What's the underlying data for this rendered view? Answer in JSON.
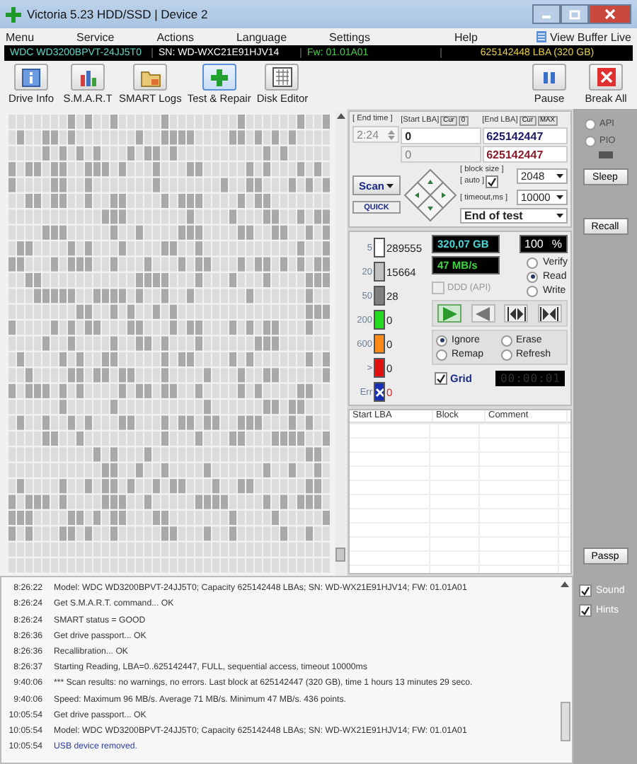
{
  "window": {
    "title": "Victoria 5.23 HDD/SSD | Device 2"
  },
  "menu": [
    {
      "label": "Menu"
    },
    {
      "label": "Service"
    },
    {
      "label": "Actions"
    },
    {
      "label": "Language"
    },
    {
      "label": "Settings"
    }
  ],
  "menu_right": {
    "help": "Help",
    "view_buffer": "View Buffer Live"
  },
  "drive_bar": {
    "model": "WDC WD3200BPVT-24JJ5T0",
    "serial": "SN: WD-WXC21E91HJV14",
    "firmware": "Fw: 01.01A01",
    "capacity": "625142448 LBA (320 GB)"
  },
  "toolbar": [
    {
      "label": "Drive Info",
      "kind": "info",
      "selected": false
    },
    {
      "label": "S.M.A.R.T",
      "kind": "smart",
      "selected": false
    },
    {
      "label": "SMART Logs",
      "kind": "logs",
      "selected": false
    },
    {
      "label": "Test & Repair",
      "kind": "test",
      "selected": true
    },
    {
      "label": "Disk Editor",
      "kind": "editor",
      "selected": false
    }
  ],
  "toolbar_right": [
    {
      "label": "Pause",
      "kind": "pause"
    },
    {
      "label": "Break All",
      "kind": "break"
    }
  ],
  "scan": {
    "end_time_label": "[ End time ]",
    "end_time": "2:24",
    "start_lba_label": "[Start LBA]",
    "start_cur": "Cur",
    "start_zero": "0",
    "end_lba_label": "[End LBA]",
    "end_cur": "Cur",
    "end_max": "MAX",
    "start_lba": "0",
    "end_lba": "625142447",
    "current_start": "0",
    "current_end": "625142447",
    "scan_button": "Scan",
    "quick": "QUICK",
    "block_size_label": "[ block size ]",
    "auto_label": "[ auto ]",
    "auto_checked": true,
    "block_size": "2048",
    "timeout_label": "[ timeout,ms ]",
    "timeout": "10000",
    "end_mode": "End of test"
  },
  "counters": [
    {
      "label": "5",
      "value": "289555",
      "color": "#ffffff",
      "kind": "block"
    },
    {
      "label": "20",
      "value": "15664",
      "color": "#c0c0c0",
      "kind": "block"
    },
    {
      "label": "50",
      "value": "28",
      "color": "#7f7f7f",
      "kind": "block"
    },
    {
      "label": "200",
      "value": "0",
      "color": "#22dd22",
      "kind": "block"
    },
    {
      "label": "600",
      "value": "0",
      "color": "#ff8a1a",
      "kind": "block"
    },
    {
      "label": ">",
      "value": "0",
      "color": "#e01010",
      "kind": "block"
    },
    {
      "label": "Err",
      "value": "0",
      "color": "#1a2fb0",
      "kind": "error"
    }
  ],
  "stats": {
    "size": "320,07 GB",
    "percent": "100",
    "percent_unit": "%",
    "speed": "47 MB/s"
  },
  "ddd": {
    "label": "DDD (API)",
    "checked": false,
    "disabled": true
  },
  "modes": [
    {
      "label": "Verify",
      "selected": false
    },
    {
      "label": "Read",
      "selected": true
    },
    {
      "label": "Write",
      "selected": false
    }
  ],
  "transport": [
    {
      "kind": "play",
      "selected": true
    },
    {
      "kind": "back",
      "selected": false
    },
    {
      "kind": "skip",
      "selected": false
    },
    {
      "kind": "end",
      "selected": false
    }
  ],
  "actions": [
    {
      "label": "Ignore",
      "selected": true
    },
    {
      "label": "Erase",
      "selected": false
    },
    {
      "label": "Remap",
      "selected": false
    },
    {
      "label": "Refresh",
      "selected": false
    }
  ],
  "grid": {
    "label": "Grid",
    "checked": true,
    "timer": "00:00:01"
  },
  "table": {
    "columns": [
      "Start LBA",
      "Block",
      "Comment"
    ]
  },
  "side": {
    "interfaces": [
      {
        "label": "API",
        "selected": false
      },
      {
        "label": "PIO",
        "selected": false
      }
    ],
    "sleep": "Sleep",
    "recall": "Recall",
    "passp": "Passp"
  },
  "log": [
    {
      "time": "8:26:22",
      "text": "Model: WDC WD3200BPVT-24JJ5T0; Capacity 625142448 LBAs; SN: WD-WX21E91HJV14; FW: 01.01A01",
      "kind": "info"
    },
    {
      "time": "8:26:24",
      "text": "Get S.M.A.R.T. command... OK",
      "kind": "info"
    },
    {
      "time": "8:26:24",
      "text": "SMART status = GOOD",
      "kind": "info"
    },
    {
      "time": "8:26:36",
      "text": "Get drive passport... OK",
      "kind": "info"
    },
    {
      "time": "8:26:36",
      "text": "Recallibration... OK",
      "kind": "info"
    },
    {
      "time": "8:26:37",
      "text": "Starting Reading, LBA=0..625142447, FULL, sequential access, timeout 10000ms",
      "kind": "info"
    },
    {
      "time": "9:40:06",
      "text": "*** Scan results: no warnings, no errors. Last block at 625142447 (320 GB), time 1 hours 13 minutes 29 seco.",
      "kind": "info"
    },
    {
      "time": "9:40:06",
      "text": "Speed: Maximum 96 MB/s. Average 71 MB/s. Minimum 47 MB/s. 436 points.",
      "kind": "info"
    },
    {
      "time": "10:05:54",
      "text": "Get drive passport... OK",
      "kind": "info"
    },
    {
      "time": "10:05:54",
      "text": "Model: WDC WD3200BPVT-24JJ5T0; Capacity 625142448 LBAs; SN: WD-WX21E91HJV14; FW: 01.01A01",
      "kind": "info"
    },
    {
      "time": "10:05:54",
      "text": "USB device removed.",
      "kind": "device"
    }
  ],
  "log_options": [
    {
      "label": "Sound",
      "checked": true
    },
    {
      "label": "Hints",
      "checked": true
    }
  ]
}
